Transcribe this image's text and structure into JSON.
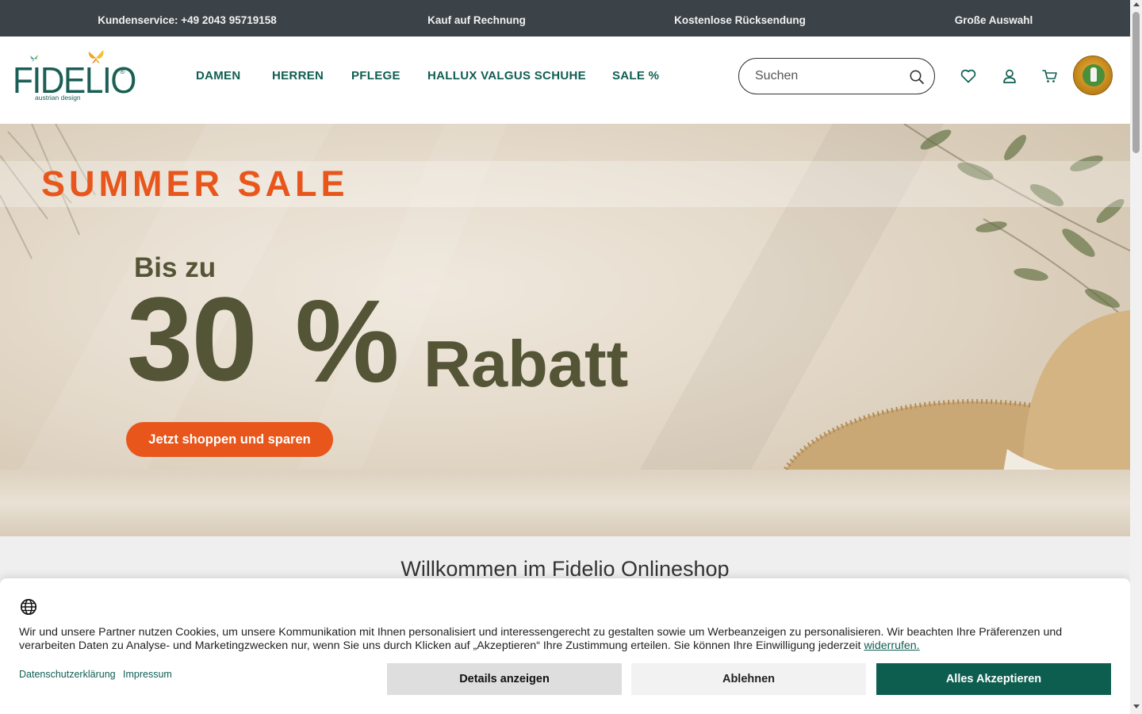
{
  "topbar": {
    "items": [
      "Kundenservice: +49 2043 95719158",
      "Kauf auf Rechnung",
      "Kostenlose Rücksendung",
      "Große Auswahl"
    ]
  },
  "header": {
    "logo": {
      "word": "FIDELIO",
      "reg": "®",
      "subtitle": "austrian design"
    },
    "nav": [
      "DAMEN",
      "HERREN",
      "PFLEGE",
      "HALLUX VALGUS SCHUHE",
      "SALE %"
    ],
    "search": {
      "placeholder": "Suchen",
      "value": ""
    },
    "icons": [
      "heart-icon",
      "user-icon",
      "cart-icon",
      "award-seal-icon"
    ]
  },
  "hero": {
    "sale_title": "SUMMER SALE",
    "pre": "Bis zu",
    "number": "30",
    "percent": "%",
    "label": "Rabatt",
    "cta": "Jetzt shoppen und sparen"
  },
  "welcome": {
    "title": "Willkommen im Fidelio Onlineshop"
  },
  "cookie": {
    "text": "Wir und unsere Partner nutzen Cookies, um unsere Kommunikation mit Ihnen personalisiert und interessengerecht zu gestalten sowie um Werbeanzeigen zu personalisieren. Wir beachten Ihre Präferenzen und verarbeiten Daten zu Analyse- und Marketingzwecken nur, wenn Sie uns durch Klicken auf „Akzeptieren“ Ihre Zustimmung erteilen. Sie können Ihre Einwilligung jederzeit",
    "revoke_link": "widerrufen.",
    "links": [
      "Datenschutzerklärung",
      "Impressum"
    ],
    "buttons": {
      "details": "Details anzeigen",
      "decline": "Ablehnen",
      "accept": "Alles Akzeptieren"
    }
  },
  "colors": {
    "topbar_bg": "#3b4248",
    "brand_green": "#0f5e52",
    "sale_orange": "#e8561c",
    "hero_text_olive": "#545436"
  }
}
